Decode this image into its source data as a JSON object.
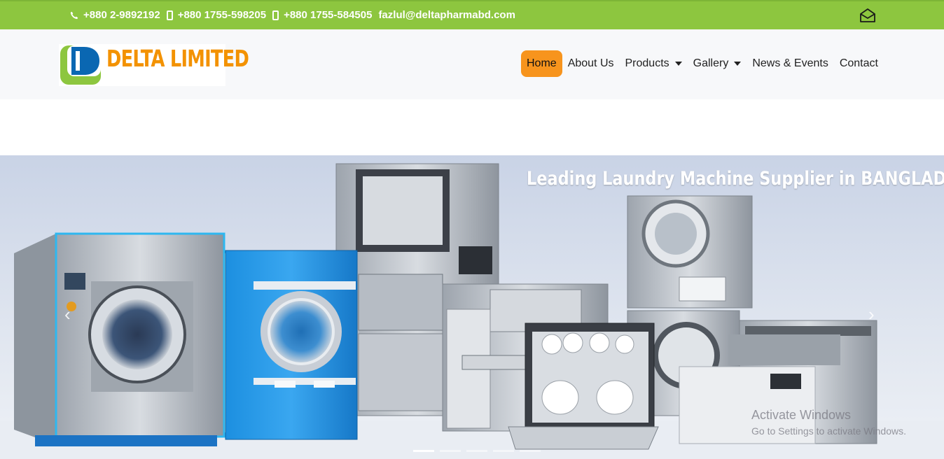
{
  "topbar": {
    "background": "#8dc63f",
    "contacts": [
      {
        "icon": "phone-icon",
        "text": "+880 2-9892192"
      },
      {
        "icon": "mobile-icon",
        "text": "+880 1755-598205"
      },
      {
        "icon": "mobile-icon",
        "text": "+880 1755-584505"
      },
      {
        "icon": "none",
        "text": "fazlul@deltapharmabd.com"
      }
    ],
    "mail_icon": "envelope-open-icon"
  },
  "header": {
    "logo_text": "DELTA LIMITED",
    "logo_colors": {
      "orange": "#f39200",
      "green": "#8dc63f",
      "blue": "#0a67b2"
    }
  },
  "nav": {
    "accent": "#f7941d",
    "items": [
      {
        "label": "Home",
        "active": true,
        "dropdown": false
      },
      {
        "label": "About Us",
        "active": false,
        "dropdown": false
      },
      {
        "label": "Products",
        "active": false,
        "dropdown": true
      },
      {
        "label": "Gallery",
        "active": false,
        "dropdown": true
      },
      {
        "label": "News & Events",
        "active": false,
        "dropdown": false
      },
      {
        "label": "Contact",
        "active": false,
        "dropdown": false
      }
    ]
  },
  "hero": {
    "title": "Leading Laundry Machine Supplier in BANGLADESH",
    "prev_icon": "chevron-left-icon",
    "next_icon": "chevron-right-icon",
    "slide_count": 5,
    "active_slide": 1
  },
  "watermark": {
    "line1": "Activate Windows",
    "line2": "Go to Settings to activate Windows."
  }
}
